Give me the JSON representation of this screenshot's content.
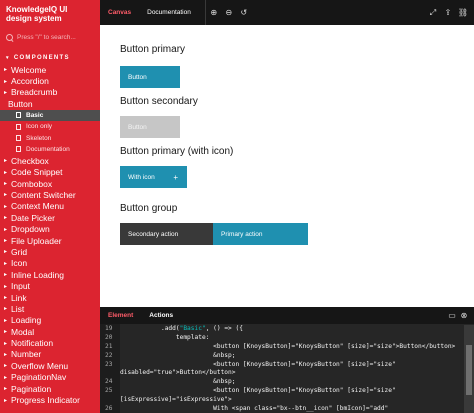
{
  "app": {
    "title": "KnowledgeIQ UI design system",
    "search_placeholder": "Press \"/\" to search..."
  },
  "sidebar": {
    "section_label": "COMPONENTS",
    "items_before": [
      "Welcome",
      "Accordion",
      "Breadcrumb"
    ],
    "open_item": "Button",
    "sub_items": [
      {
        "label": "Basic",
        "active": true
      },
      {
        "label": "Icon only",
        "active": false
      },
      {
        "label": "Skeleton",
        "active": false
      },
      {
        "label": "Documentation",
        "active": false
      }
    ],
    "items_after": [
      "Checkbox",
      "Code Snippet",
      "Combobox",
      "Content Switcher",
      "Context Menu",
      "Date Picker",
      "Dropdown",
      "File Uploader",
      "Grid",
      "Icon",
      "Inline Loading",
      "Input",
      "Link",
      "List",
      "Loading",
      "Modal",
      "Notification",
      "Number",
      "Overflow Menu",
      "PaginationNav",
      "Pagination",
      "Progress Indicator"
    ]
  },
  "toolbar": {
    "tabs": [
      "Canvas",
      "Documentation"
    ],
    "icons": [
      "zoom-in-icon",
      "zoom-out-icon",
      "zoom-reset-icon",
      "fullscreen-icon",
      "share-icon",
      "link-icon"
    ]
  },
  "canvas": {
    "groups": [
      {
        "title": "Button primary",
        "button": "Button"
      },
      {
        "title": "Button secondary",
        "button": "Button"
      },
      {
        "title": "Button primary (with icon)",
        "button": "With icon",
        "icon": "+"
      },
      {
        "title": "Button group",
        "buttons": [
          "Secondary action",
          "Primary action"
        ]
      }
    ]
  },
  "panel": {
    "tabs": [
      "Element",
      "Actions"
    ],
    "icons": [
      "panel-layout-icon",
      "reset-icon"
    ],
    "code_lines": [
      {
        "n": "19",
        "html": "           .add(<span class=\"str\">\"Basic\"</span>, () =&gt; ({"
      },
      {
        "n": "20",
        "html": "               template:"
      },
      {
        "n": "21",
        "html": "                         &lt;button [KnoysButton]=\"KnoysButton\" [size]=\"size\"&gt;Button&lt;/button&gt;"
      },
      {
        "n": "22",
        "html": "                         &amp;nbsp;"
      },
      {
        "n": "23",
        "html": "                         &lt;button [KnoysButton]=\"KnoysButton\" [size]=\"size\""
      },
      {
        "n": "",
        "html": "disabled=\"true\"&gt;Button&lt;/button&gt;"
      },
      {
        "n": "24",
        "html": "                         &amp;nbsp;"
      },
      {
        "n": "25",
        "html": "                         &lt;button [KnoysButton]=\"KnoysButton\" [size]=\"size\""
      },
      {
        "n": "",
        "html": "[isExpressive]=\"isExpressive\"&gt;"
      },
      {
        "n": "26",
        "html": "                         With &lt;span class=\"bx--btn__icon\" [bmIcon]=\"add\""
      }
    ]
  },
  "colors": {
    "sidebar_bg": "#dc2430",
    "toolbar_bg": "#161616",
    "primary_button": "#1f90b0",
    "disabled_button": "#c6c6c6",
    "secondary_button": "#393939",
    "active_tab": "#ff5c69"
  }
}
